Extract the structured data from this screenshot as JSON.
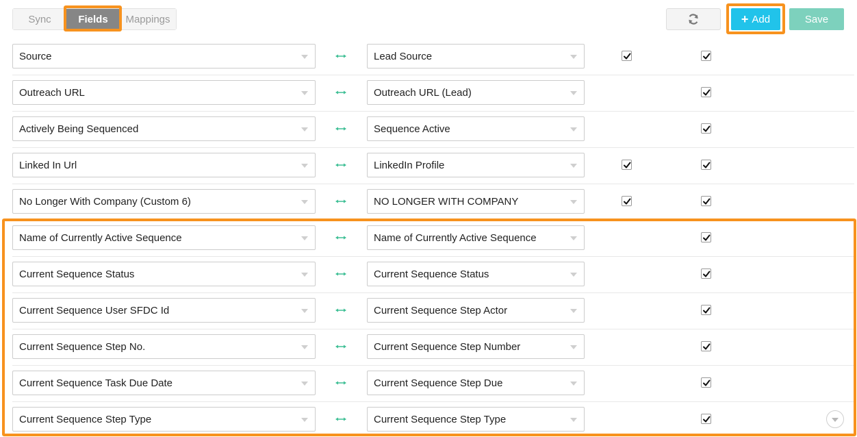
{
  "toolbar": {
    "tabs": [
      {
        "label": "Sync",
        "active": false
      },
      {
        "label": "Fields",
        "active": true
      },
      {
        "label": "Mappings",
        "active": false
      }
    ],
    "refresh_icon": "refresh-icon",
    "add_label": "Add",
    "add_icon": "plus-icon",
    "save_label": "Save"
  },
  "colors": {
    "highlight": "#f7921e",
    "add_button": "#21c3ea",
    "save_button": "#7dd1bd",
    "mapping_arrow": "#3fbf95"
  },
  "mappings": [
    {
      "source": "Source",
      "target": "Lead Source",
      "check1": true,
      "check2": true
    },
    {
      "source": "Outreach URL",
      "target": "Outreach URL (Lead)",
      "check1": false,
      "check2": true
    },
    {
      "source": "Actively Being Sequenced",
      "target": "Sequence Active",
      "check1": false,
      "check2": true
    },
    {
      "source": "Linked In Url",
      "target": "LinkedIn Profile",
      "check1": true,
      "check2": true
    },
    {
      "source": "No Longer With Company (Custom 6)",
      "target": "NO LONGER WITH COMPANY",
      "check1": true,
      "check2": true
    },
    {
      "source": "Name of Currently Active Sequence",
      "target": "Name of Currently Active Sequence",
      "check1": false,
      "check2": true
    },
    {
      "source": "Current Sequence Status",
      "target": "Current Sequence Status",
      "check1": false,
      "check2": true
    },
    {
      "source": "Current Sequence User SFDC Id",
      "target": "Current Sequence Step Actor",
      "check1": false,
      "check2": true
    },
    {
      "source": "Current Sequence Step No.",
      "target": "Current Sequence Step Number",
      "check1": false,
      "check2": true
    },
    {
      "source": "Current Sequence Task Due Date",
      "target": "Current Sequence Step Due",
      "check1": false,
      "check2": true
    },
    {
      "source": "Current Sequence Step Type",
      "target": "Current Sequence Step Type",
      "check1": false,
      "check2": true
    }
  ]
}
